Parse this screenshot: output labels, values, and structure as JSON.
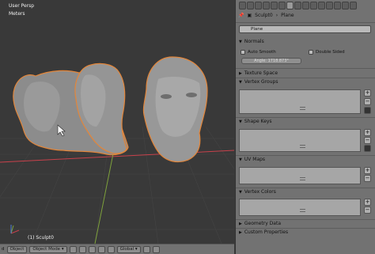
{
  "viewport": {
    "view_label": "User Persp",
    "units_label": "Meters",
    "object_info": "(1) Sculpt0"
  },
  "header3d": {
    "menu_left": "d",
    "object_menu": "Object",
    "mode_select": "Object Mode",
    "orientation_select": "Global"
  },
  "properties": {
    "breadcrumb_object": "Sculpt0",
    "breadcrumb_data": "Plane",
    "data_name": "Plane",
    "panels": {
      "normals": "Normals",
      "auto_smooth": "Auto Smooth",
      "double_sided": "Double Sided",
      "angle_field": "Angle:    1718.873°",
      "texture_space": "Texture Space",
      "vertex_groups": "Vertex Groups",
      "shape_keys": "Shape Keys",
      "uv_maps": "UV Maps",
      "vertex_colors": "Vertex Colors",
      "geometry_data": "Geometry Data",
      "custom_properties": "Custom Properties"
    }
  },
  "colors": {
    "viewport_bg": "#393939",
    "grid_x_axis": "#c8414b",
    "grid_y_axis": "#7ea13c",
    "head_outline": "#e3863a",
    "panel_bg": "#727272"
  }
}
